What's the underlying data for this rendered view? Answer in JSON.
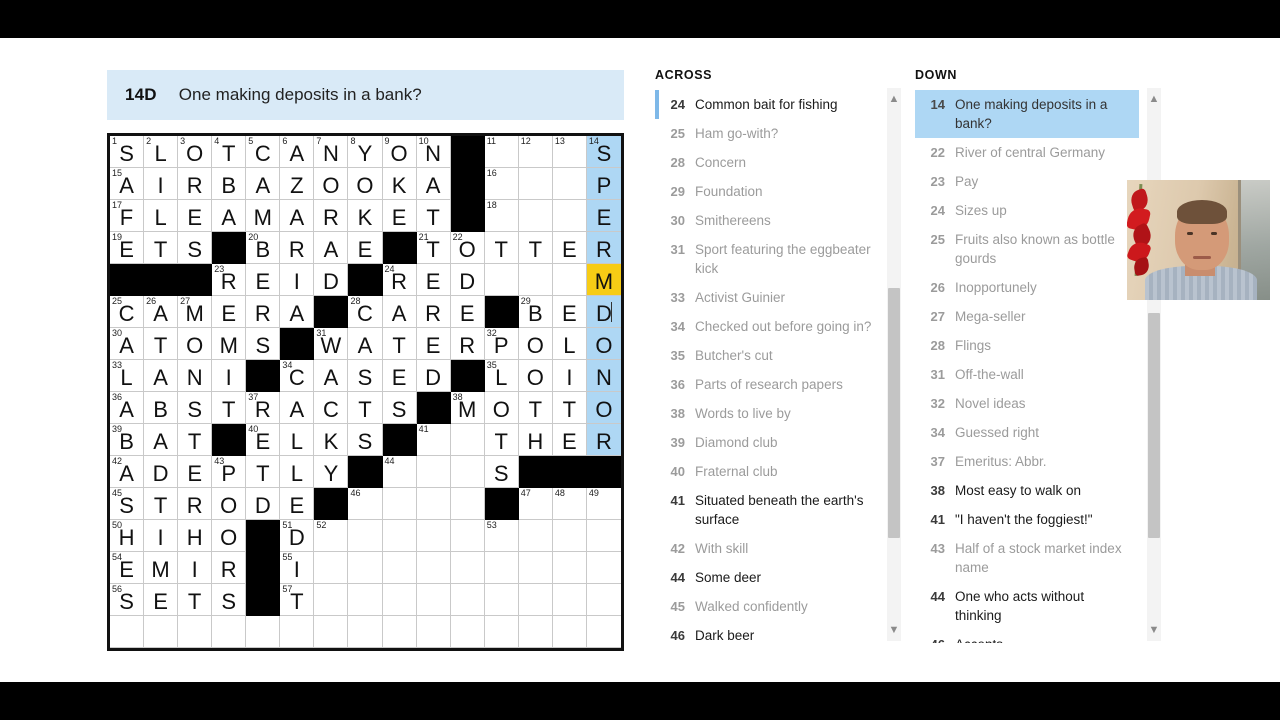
{
  "clue_banner": {
    "number": "14D",
    "text": "One making deposits in a bank?"
  },
  "grid": {
    "columns": 15,
    "rows": 16,
    "highlight_color": "#aed7f4",
    "cursor_color": "#f7cc15",
    "cells": [
      [
        {
          "n": "1",
          "l": "S"
        },
        {
          "n": "2",
          "l": "L"
        },
        {
          "n": "3",
          "l": "O"
        },
        {
          "n": "4",
          "l": "T"
        },
        {
          "n": "5",
          "l": "C"
        },
        {
          "n": "6",
          "l": "A"
        },
        {
          "n": "7",
          "l": "N"
        },
        {
          "n": "8",
          "l": "Y"
        },
        {
          "n": "9",
          "l": "O"
        },
        {
          "n": "10",
          "l": "N"
        },
        {
          "b": true
        },
        {
          "n": "11",
          "l": ""
        },
        {
          "n": "12",
          "l": ""
        },
        {
          "n": "13",
          "l": ""
        },
        {
          "n": "14",
          "l": "S",
          "h": true
        }
      ],
      [
        {
          "n": "15",
          "l": "A"
        },
        {
          "l": "I"
        },
        {
          "l": "R"
        },
        {
          "l": "B"
        },
        {
          "l": "A"
        },
        {
          "l": "Z"
        },
        {
          "l": "O"
        },
        {
          "l": "O"
        },
        {
          "l": "K"
        },
        {
          "l": "A"
        },
        {
          "b": true
        },
        {
          "n": "16",
          "l": ""
        },
        {
          "l": ""
        },
        {
          "l": ""
        },
        {
          "l": "P",
          "h": true
        }
      ],
      [
        {
          "n": "17",
          "l": "F"
        },
        {
          "l": "L"
        },
        {
          "l": "E"
        },
        {
          "l": "A"
        },
        {
          "l": "M"
        },
        {
          "l": "A"
        },
        {
          "l": "R"
        },
        {
          "l": "K"
        },
        {
          "l": "E"
        },
        {
          "l": "T"
        },
        {
          "b": true
        },
        {
          "n": "18",
          "l": ""
        },
        {
          "l": ""
        },
        {
          "l": ""
        },
        {
          "l": "E",
          "h": true
        }
      ],
      [
        {
          "n": "19",
          "l": "E"
        },
        {
          "l": "T"
        },
        {
          "l": "S"
        },
        {
          "b": true
        },
        {
          "n": "20",
          "l": "B"
        },
        {
          "l": "R"
        },
        {
          "l": "A"
        },
        {
          "l": "E"
        },
        {
          "b": true
        },
        {
          "n": "21",
          "l": "T"
        },
        {
          "n": "22",
          "l": "O"
        },
        {
          "l": "T"
        },
        {
          "l": "T"
        },
        {
          "l": "E"
        },
        {
          "l": "R",
          "h": true
        }
      ],
      [
        {
          "b": true
        },
        {
          "b": true
        },
        {
          "b": true
        },
        {
          "n": "23",
          "l": "R"
        },
        {
          "l": "E"
        },
        {
          "l": "I"
        },
        {
          "l": "D"
        },
        {
          "b": true
        },
        {
          "n": "24",
          "l": "R"
        },
        {
          "l": "E"
        },
        {
          "l": "D"
        },
        {
          "l": ""
        },
        {
          "l": ""
        },
        {
          "l": ""
        },
        {
          "l": "M",
          "cur": true
        }
      ],
      [
        {
          "n": "25",
          "l": "C"
        },
        {
          "n": "26",
          "l": "A"
        },
        {
          "n": "27",
          "l": "M"
        },
        {
          "l": "E"
        },
        {
          "l": "R"
        },
        {
          "l": "A"
        },
        {
          "b": true
        },
        {
          "n": "28",
          "l": "C"
        },
        {
          "l": "A"
        },
        {
          "l": "R"
        },
        {
          "l": "E"
        },
        {
          "b": true
        },
        {
          "n": "29",
          "l": "B"
        },
        {
          "l": "E"
        },
        {
          "l": "D",
          "h": true,
          "caret": true
        }
      ],
      [
        {
          "n": "30",
          "l": "A"
        },
        {
          "l": "T"
        },
        {
          "l": "O"
        },
        {
          "l": "M"
        },
        {
          "l": "S"
        },
        {
          "b": true
        },
        {
          "n": "31",
          "l": "W"
        },
        {
          "l": "A"
        },
        {
          "l": "T"
        },
        {
          "l": "E"
        },
        {
          "l": "R"
        },
        {
          "n": "32",
          "l": "P"
        },
        {
          "l": "O"
        },
        {
          "l": "L"
        },
        {
          "l": "O",
          "h": true
        }
      ],
      [
        {
          "n": "33",
          "l": "L"
        },
        {
          "l": "A"
        },
        {
          "l": "N"
        },
        {
          "l": "I"
        },
        {
          "b": true
        },
        {
          "n": "34",
          "l": "C"
        },
        {
          "l": "A"
        },
        {
          "l": "S"
        },
        {
          "l": "E"
        },
        {
          "l": "D"
        },
        {
          "b": true
        },
        {
          "n": "35",
          "l": "L"
        },
        {
          "l": "O"
        },
        {
          "l": "I"
        },
        {
          "l": "N",
          "h": true
        }
      ],
      [
        {
          "n": "36",
          "l": "A"
        },
        {
          "l": "B"
        },
        {
          "l": "S"
        },
        {
          "l": "T"
        },
        {
          "n": "37",
          "l": "R"
        },
        {
          "l": "A"
        },
        {
          "l": "C"
        },
        {
          "l": "T"
        },
        {
          "l": "S"
        },
        {
          "b": true
        },
        {
          "n": "38",
          "l": "M"
        },
        {
          "l": "O"
        },
        {
          "l": "T"
        },
        {
          "l": "T"
        },
        {
          "l": "O",
          "h": true
        }
      ],
      [
        {
          "n": "39",
          "l": "B"
        },
        {
          "l": "A"
        },
        {
          "l": "T"
        },
        {
          "b": true
        },
        {
          "n": "40",
          "l": "E"
        },
        {
          "l": "L"
        },
        {
          "l": "K"
        },
        {
          "l": "S"
        },
        {
          "b": true
        },
        {
          "n": "41",
          "l": ""
        },
        {
          "l": ""
        },
        {
          "l": "T"
        },
        {
          "l": "H"
        },
        {
          "l": "E"
        },
        {
          "l": "R",
          "h": true
        }
      ],
      [
        {
          "n": "42",
          "l": "A"
        },
        {
          "l": "D"
        },
        {
          "l": "E"
        },
        {
          "n": "43",
          "l": "P"
        },
        {
          "l": "T"
        },
        {
          "l": "L"
        },
        {
          "l": "Y"
        },
        {
          "b": true
        },
        {
          "n": "44",
          "l": ""
        },
        {
          "l": ""
        },
        {
          "l": ""
        },
        {
          "l": "S"
        },
        {
          "b": true
        },
        {
          "b": true
        },
        {
          "b": true
        }
      ],
      [
        {
          "n": "45",
          "l": "S"
        },
        {
          "l": "T"
        },
        {
          "l": "R"
        },
        {
          "l": "O"
        },
        {
          "l": "D"
        },
        {
          "l": "E"
        },
        {
          "b": true
        },
        {
          "n": "46",
          "l": ""
        },
        {
          "l": ""
        },
        {
          "l": ""
        },
        {
          "l": ""
        },
        {
          "b": true
        },
        {
          "n": "47",
          "l": ""
        },
        {
          "n": "48",
          "l": ""
        },
        {
          "n": "49",
          "l": ""
        }
      ],
      [
        {
          "n": "50",
          "l": "H"
        },
        {
          "l": "I"
        },
        {
          "l": "H"
        },
        {
          "l": "O"
        },
        {
          "b": true
        },
        {
          "n": "51",
          "l": "D"
        },
        {
          "n": "52",
          "l": ""
        },
        {
          "l": ""
        },
        {
          "l": ""
        },
        {
          "l": ""
        },
        {
          "l": ""
        },
        {
          "n": "53",
          "l": ""
        },
        {
          "l": ""
        },
        {
          "l": ""
        },
        {
          "l": ""
        }
      ],
      [
        {
          "n": "54",
          "l": "E"
        },
        {
          "l": "M"
        },
        {
          "l": "I"
        },
        {
          "l": "R"
        },
        {
          "b": true
        },
        {
          "n": "55",
          "l": "I"
        },
        {
          "l": ""
        },
        {
          "l": ""
        },
        {
          "l": ""
        },
        {
          "l": ""
        },
        {
          "l": ""
        },
        {
          "l": ""
        },
        {
          "l": ""
        },
        {
          "l": ""
        },
        {
          "l": ""
        }
      ],
      [
        {
          "n": "56",
          "l": "S"
        },
        {
          "l": "E"
        },
        {
          "l": "T"
        },
        {
          "l": "S"
        },
        {
          "b": true
        },
        {
          "n": "57",
          "l": "T"
        },
        {
          "l": ""
        },
        {
          "l": ""
        },
        {
          "l": ""
        },
        {
          "l": ""
        },
        {
          "l": ""
        },
        {
          "l": ""
        },
        {
          "l": ""
        },
        {
          "l": ""
        },
        {
          "l": ""
        }
      ],
      [
        {
          "l": ""
        },
        {
          "l": ""
        },
        {
          "l": ""
        },
        {
          "l": ""
        },
        {
          "l": ""
        },
        {
          "l": ""
        },
        {
          "l": ""
        },
        {
          "l": ""
        },
        {
          "l": ""
        },
        {
          "l": ""
        },
        {
          "l": ""
        },
        {
          "l": ""
        },
        {
          "l": ""
        },
        {
          "l": ""
        },
        {
          "l": ""
        }
      ]
    ]
  },
  "across": {
    "title": "ACROSS",
    "clues": [
      {
        "n": "24",
        "t": "Common bait for fishing",
        "state": "unsolved",
        "marker": true
      },
      {
        "n": "25",
        "t": "Ham go-with?",
        "state": "solved"
      },
      {
        "n": "28",
        "t": "Concern",
        "state": "solved"
      },
      {
        "n": "29",
        "t": "Foundation",
        "state": "solved"
      },
      {
        "n": "30",
        "t": "Smithereens",
        "state": "solved"
      },
      {
        "n": "31",
        "t": "Sport featuring the eggbeater kick",
        "state": "solved"
      },
      {
        "n": "33",
        "t": "Activist Guinier",
        "state": "solved"
      },
      {
        "n": "34",
        "t": "Checked out before going in?",
        "state": "solved"
      },
      {
        "n": "35",
        "t": "Butcher's cut",
        "state": "solved"
      },
      {
        "n": "36",
        "t": "Parts of research papers",
        "state": "solved"
      },
      {
        "n": "38",
        "t": "Words to live by",
        "state": "solved"
      },
      {
        "n": "39",
        "t": "Diamond club",
        "state": "solved"
      },
      {
        "n": "40",
        "t": "Fraternal club",
        "state": "solved"
      },
      {
        "n": "41",
        "t": "Situated beneath the earth's surface",
        "state": "unsolved"
      },
      {
        "n": "42",
        "t": "With skill",
        "state": "solved"
      },
      {
        "n": "44",
        "t": "Some deer",
        "state": "unsolved"
      },
      {
        "n": "45",
        "t": "Walked confidently",
        "state": "solved"
      },
      {
        "n": "46",
        "t": "Dark beer",
        "state": "unsolved"
      }
    ],
    "scrollbar": {
      "up": "▲",
      "down": "▼"
    }
  },
  "down": {
    "title": "DOWN",
    "clues": [
      {
        "n": "14",
        "t": "One making deposits in a bank?",
        "state": "active"
      },
      {
        "n": "22",
        "t": "River of central Germany",
        "state": "solved"
      },
      {
        "n": "23",
        "t": "Pay",
        "state": "solved"
      },
      {
        "n": "24",
        "t": "Sizes up",
        "state": "solved"
      },
      {
        "n": "25",
        "t": "Fruits also known as bottle gourds",
        "state": "solved"
      },
      {
        "n": "26",
        "t": "Inopportunely",
        "state": "solved"
      },
      {
        "n": "27",
        "t": "Mega-seller",
        "state": "solved"
      },
      {
        "n": "28",
        "t": "Flings",
        "state": "solved"
      },
      {
        "n": "31",
        "t": "Off-the-wall",
        "state": "solved"
      },
      {
        "n": "32",
        "t": "Novel ideas",
        "state": "solved"
      },
      {
        "n": "34",
        "t": "Guessed right",
        "state": "solved"
      },
      {
        "n": "37",
        "t": "Emeritus: Abbr.",
        "state": "solved"
      },
      {
        "n": "38",
        "t": "Most easy to walk on",
        "state": "unsolved"
      },
      {
        "n": "41",
        "t": "\"I haven't the foggiest!\"",
        "state": "unsolved"
      },
      {
        "n": "43",
        "t": "Half of a stock market index name",
        "state": "solved"
      },
      {
        "n": "44",
        "t": "One who acts without thinking",
        "state": "unsolved"
      },
      {
        "n": "46",
        "t": "Accepts",
        "state": "unsolved"
      }
    ],
    "scrollbar": {
      "up": "▲",
      "down": "▼"
    }
  }
}
